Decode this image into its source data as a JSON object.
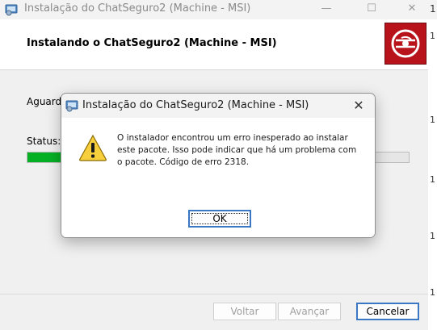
{
  "window": {
    "title": "Instalação do ChatSeguro2 (Machine - MSI)",
    "minimize_glyph": "—",
    "maximize_glyph": "☐",
    "close_glyph": "✕",
    "edge_digit": "1"
  },
  "header": {
    "title": "Instalando o ChatSeguro2 (Machine - MSI)",
    "logo_icon": "installer-disc-icon",
    "logo_color": "#b8121b"
  },
  "right_strip_digits": [
    "1",
    "1",
    "1",
    "1",
    "1"
  ],
  "main": {
    "wait_text": "Aguarde",
    "status_label": "Status:",
    "progress": 0.14,
    "progress_color": "#06b025"
  },
  "footer": {
    "back_label": "Voltar",
    "next_label": "Avançar",
    "cancel_label": "Cancelar"
  },
  "dialog": {
    "title": "Instalação do ChatSeguro2 (Machine - MSI)",
    "close_glyph": "✕",
    "icon": "warning-icon",
    "message": "O instalador encontrou um erro inesperado ao instalar este pacote. Isso pode indicar que há um problema com o pacote. Código de erro 2318.",
    "ok_label": "OK",
    "accent_color": "#3b78c4"
  }
}
